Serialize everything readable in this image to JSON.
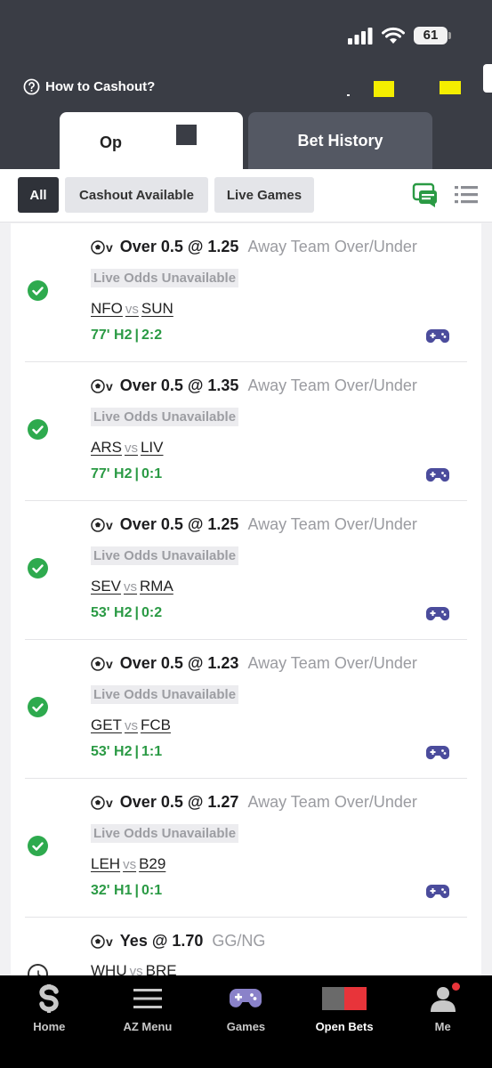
{
  "status_bar": {
    "battery": "61"
  },
  "header": {
    "help_label": "How to Cashout?"
  },
  "tabs": {
    "open_label": "Op",
    "history_label": "Bet History"
  },
  "filters": {
    "all": "All",
    "cashout": "Cashout Available",
    "live": "Live Games"
  },
  "bets": [
    {
      "pick": "Over 0.5 @ 1.25",
      "market": "Away Team Over/Under",
      "badge": "Live Odds Unavailable",
      "home": "NFO",
      "vs": "vs",
      "away": "SUN",
      "time": "77' H2",
      "score": "2:2"
    },
    {
      "pick": "Over 0.5 @ 1.35",
      "market": "Away Team Over/Under",
      "badge": "Live Odds Unavailable",
      "home": "ARS",
      "vs": "vs",
      "away": "LIV",
      "time": "77' H2",
      "score": "0:1"
    },
    {
      "pick": "Over 0.5 @ 1.25",
      "market": "Away Team Over/Under",
      "badge": "Live Odds Unavailable",
      "home": "SEV",
      "vs": "vs",
      "away": "RMA",
      "time": "53' H2",
      "score": "0:2"
    },
    {
      "pick": "Over 0.5 @ 1.23",
      "market": "Away Team Over/Under",
      "badge": "Live Odds Unavailable",
      "home": "GET",
      "vs": "vs",
      "away": "FCB",
      "time": "53' H2",
      "score": "1:1"
    },
    {
      "pick": "Over 0.5 @ 1.27",
      "market": "Away Team Over/Under",
      "badge": "Live Odds Unavailable",
      "home": "LEH",
      "vs": "vs",
      "away": "B29",
      "time": "32' H1",
      "score": "0:1"
    },
    {
      "pick": "Yes @ 1.70",
      "market": "GG/NG",
      "home": "WHU",
      "vs": "vs",
      "away": "BRE"
    }
  ],
  "nav": {
    "home": "Home",
    "az_menu": "AZ Menu",
    "games": "Games",
    "open_bets": "Open Bets",
    "me": "Me"
  },
  "colors": {
    "header": "#3a3d45",
    "win_green": "#2eaa4e",
    "score_green": "#2a9a44",
    "gamepad_purple": "#4b4c9c",
    "accent_red": "#e8343a"
  }
}
